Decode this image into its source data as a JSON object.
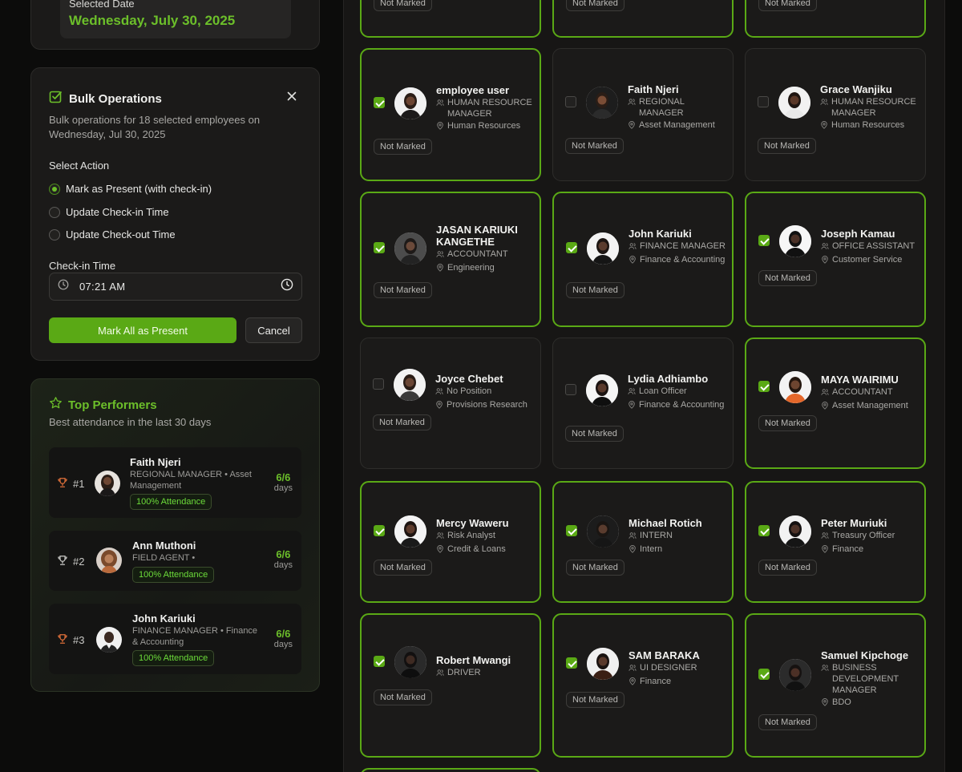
{
  "selected_date": {
    "label": "Selected Date",
    "value": "Wednesday, July 30, 2025"
  },
  "bulk": {
    "title": "Bulk Operations",
    "description": "Bulk operations for 18 selected employees on Wednesday, Jul 30, 2025",
    "select_action_label": "Select Action",
    "actions": [
      {
        "label": "Mark as Present (with check-in)",
        "selected": true
      },
      {
        "label": "Update Check-in Time",
        "selected": false
      },
      {
        "label": "Update Check-out Time",
        "selected": false
      }
    ],
    "checkin_label": "Check-in Time",
    "checkin_value": "07:21 AM",
    "primary_button": "Mark All as Present",
    "cancel_button": "Cancel"
  },
  "performers": {
    "title": "Top Performers",
    "subtitle": "Best attendance in the last 30 days",
    "items": [
      {
        "rank": "#1",
        "name": "Faith Njeri",
        "role": "REGIONAL MANAGER • Asset Management",
        "badge": "100% Attendance",
        "score": "6/6",
        "unit": "days"
      },
      {
        "rank": "#2",
        "name": "Ann Muthoni",
        "role": "FIELD AGENT •",
        "badge": "100% Attendance",
        "score": "6/6",
        "unit": "days"
      },
      {
        "rank": "#3",
        "name": "John Kariuki",
        "role": "FINANCE MANAGER • Finance & Accounting",
        "badge": "100% Attendance",
        "score": "6/6",
        "unit": "days"
      }
    ]
  },
  "top_partial_status": "Not Marked",
  "employees": [
    {
      "name": "employee user",
      "position": "HUMAN RESOURCE MANAGER",
      "department": "Human Resources",
      "status": "Not Marked",
      "selected": true
    },
    {
      "name": "Faith Njeri",
      "position": "REGIONAL MANAGER",
      "department": "Asset Management",
      "status": "Not Marked",
      "selected": false
    },
    {
      "name": "Grace Wanjiku",
      "position": "HUMAN RESOURCE MANAGER",
      "department": "Human Resources",
      "status": "Not Marked",
      "selected": false
    },
    {
      "name": "JASAN KARIUKI KANGETHE",
      "position": "ACCOUNTANT",
      "department": "Engineering",
      "status": "Not Marked",
      "selected": true
    },
    {
      "name": "John Kariuki",
      "position": "FINANCE MANAGER",
      "department": "Finance & Accounting",
      "status": "Not Marked",
      "selected": true
    },
    {
      "name": "Joseph Kamau",
      "position": "OFFICE ASSISTANT",
      "department": "Customer Service",
      "status": "Not Marked",
      "selected": true
    },
    {
      "name": "Joyce Chebet",
      "position": "No Position",
      "department": "Provisions Research",
      "status": "Not Marked",
      "selected": false
    },
    {
      "name": "Lydia Adhiambo",
      "position": "Loan Officer",
      "department": "Finance & Accounting",
      "status": "Not Marked",
      "selected": false
    },
    {
      "name": "MAYA WAIRIMU",
      "position": "ACCOUNTANT",
      "department": "Asset Management",
      "status": "Not Marked",
      "selected": true
    },
    {
      "name": "Mercy Waweru",
      "position": "Risk Analyst",
      "department": "Credit & Loans",
      "status": "Not Marked",
      "selected": true
    },
    {
      "name": "Michael Rotich",
      "position": "INTERN",
      "department": "Intern",
      "status": "Not Marked",
      "selected": true
    },
    {
      "name": "Peter Muriuki",
      "position": "Treasury Officer",
      "department": "Finance",
      "status": "Not Marked",
      "selected": true
    },
    {
      "name": "Robert Mwangi",
      "position": "DRIVER",
      "department": "",
      "status": "Not Marked",
      "selected": true
    },
    {
      "name": "SAM BARAKA",
      "position": "UI DESIGNER",
      "department": "Finance",
      "status": "Not Marked",
      "selected": true
    },
    {
      "name": "Samuel Kipchoge",
      "position": "BUSINESS DEVELOPMENT MANAGER",
      "department": "BDO",
      "status": "Not Marked",
      "selected": true
    }
  ],
  "colors": {
    "accent": "#5aa915",
    "accent_text": "#6cbf2a",
    "background": "#0c0c0b",
    "card": "#1b1a19"
  },
  "icons": {
    "check": "check-square-icon",
    "close": "close-icon",
    "clock": "clock-icon",
    "star": "star-icon",
    "trophy": "trophy-icon",
    "users": "users-icon",
    "location": "location-pin-icon"
  }
}
